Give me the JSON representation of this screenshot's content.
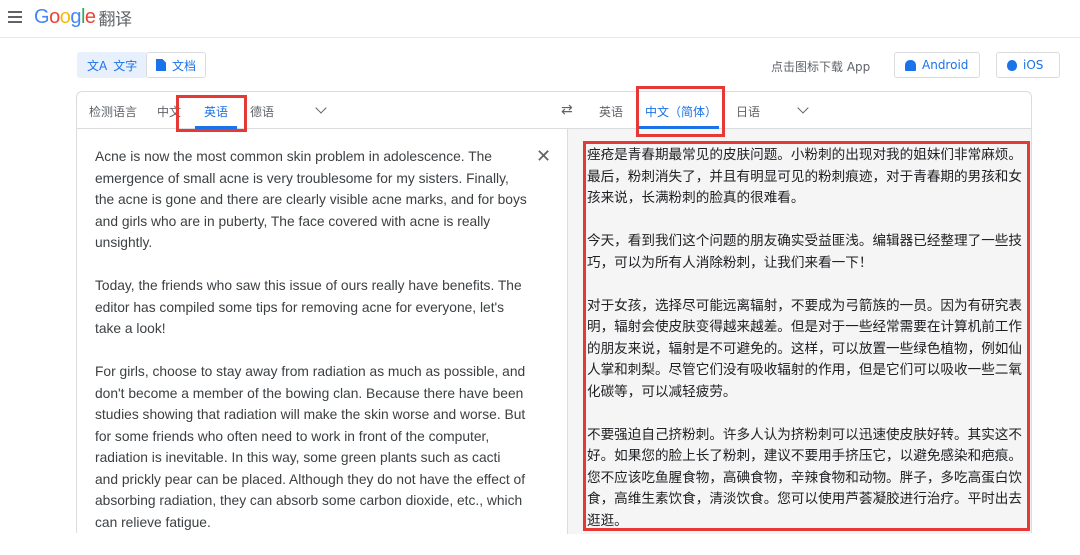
{
  "header": {
    "logo": "Google",
    "product": "翻译"
  },
  "modes": {
    "text_label": "文字",
    "document_label": "文档"
  },
  "download": {
    "label": "点击图标下载 App",
    "android_label": "Android",
    "ios_label": "iOS"
  },
  "source_languages": {
    "detect": "检测语言",
    "chinese": "中文",
    "english": "英语",
    "german": "德语"
  },
  "target_languages": {
    "english": "英语",
    "chinese_simplified": "中文（简体）",
    "japanese": "日语"
  },
  "source": {
    "paragraphs": [
      "Acne is now the most common skin problem in adolescence. The emergence of small acne is very troublesome for my sisters. Finally, the acne is gone and there are clearly visible acne marks, and for boys and girls who are in puberty, The face covered with acne is really unsightly.",
      "Today, the friends who saw this issue of ours really have benefits. The editor has compiled some tips for removing acne for everyone, let's take a look!",
      "For girls, choose to stay away from radiation as much as possible, and don't become a member of the bowing clan. Because there have been studies showing that radiation will make the skin worse and worse. But for some friends who often need to work in front of the computer, radiation is inevitable. In this way, some green plants such as cacti and prickly pear can be placed. Although they do not have the effect of absorbing radiation, they can absorb some carbon dioxide, etc., which can relieve fatigue."
    ]
  },
  "target": {
    "paragraphs": [
      "痤疮是青春期最常见的皮肤问题。小粉刺的出现对我的姐妹们非常麻烦。最后，粉刺消失了，并且有明显可见的粉刺痕迹，对于青春期的男孩和女孩来说，长满粉刺的脸真的很难看。",
      "今天，看到我们这个问题的朋友确实受益匪浅。编辑器已经整理了一些技巧，可以为所有人消除粉刺，让我们来看一下！",
      "对于女孩，选择尽可能远离辐射，不要成为弓箭族的一员。因为有研究表明，辐射会使皮肤变得越来越差。但是对于一些经常需要在计算机前工作的朋友来说，辐射是不可避免的。这样，可以放置一些绿色植物，例如仙人掌和刺梨。尽管它们没有吸收辐射的作用，但是它们可以吸收一些二氧化碳等，可以减轻疲劳。",
      "不要强迫自己挤粉刺。许多人认为挤粉刺可以迅速使皮肤好转。其实这不好。如果您的脸上长了粉刺，建议不要用手挤压它，以避免感染和疤痕。您不应该吃鱼腥食物，高碘食物，辛辣食物和动物。胖子，多吃高蛋白饮食，高维生素饮食，清淡饮食。您可以使用芦荟凝胶进行治疗。平时出去逛逛。"
    ]
  },
  "colors": {
    "accent": "#1a73e8",
    "annotation": "#e53935"
  }
}
